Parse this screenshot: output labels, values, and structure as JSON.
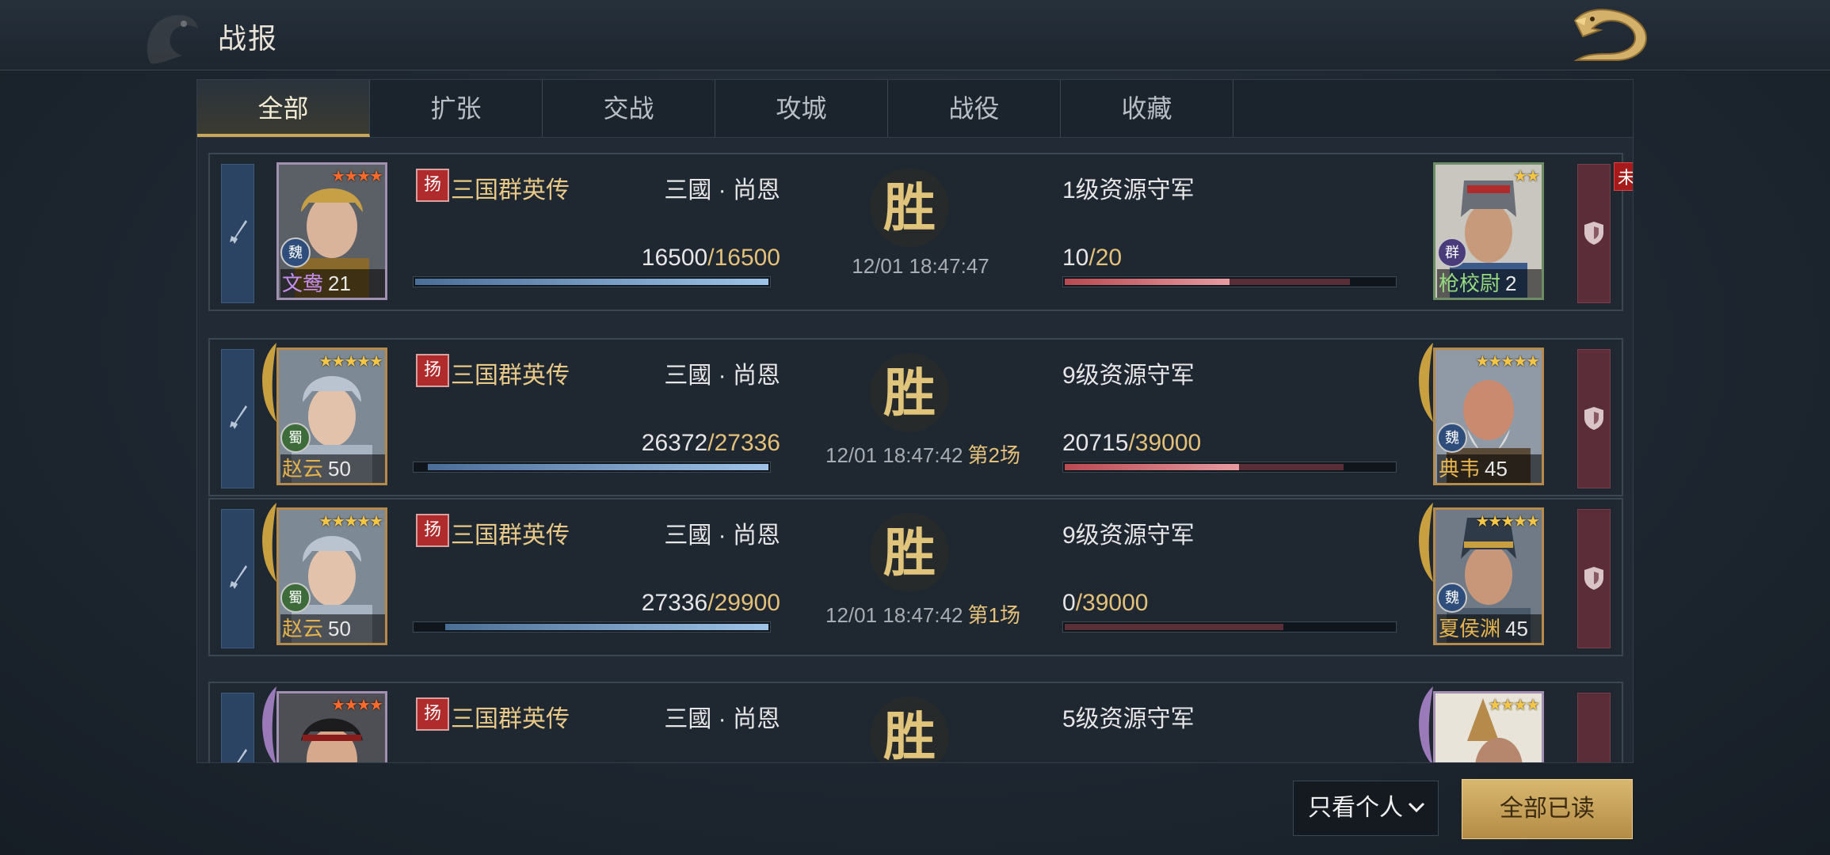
{
  "header": {
    "title": "战报",
    "back_icon": "dragon-back-icon"
  },
  "tabs": [
    {
      "label": "全部",
      "active": true
    },
    {
      "label": "扩张",
      "active": false
    },
    {
      "label": "交战",
      "active": false
    },
    {
      "label": "攻城",
      "active": false
    },
    {
      "label": "战役",
      "active": false
    },
    {
      "label": "收藏",
      "active": false
    }
  ],
  "unread_label": "未读",
  "reports": [
    {
      "server_tag": "扬",
      "server_name": "三国群英传",
      "player": "三國 · 尚恩",
      "attacker": {
        "name": "文鸯",
        "level": "21",
        "faction": "魏",
        "stars": "★★★★"
      },
      "att_troops": "16500",
      "att_max": "/16500",
      "att_ratio": 1.0,
      "result": "胜",
      "time": "12/01 18:47:47",
      "round": "",
      "enemy": "1级资源守军",
      "def_troops": "10",
      "def_max": "/20",
      "def_ratio": 0.5,
      "defender": {
        "name": "枪校尉",
        "level": "2",
        "faction": "群",
        "stars": "★★"
      }
    },
    {
      "server_tag": "扬",
      "server_name": "三国群英传",
      "player": "三國 · 尚恩",
      "attacker": {
        "name": "赵云",
        "level": "50",
        "faction": "蜀",
        "stars": "★★★★★"
      },
      "att_troops": "26372",
      "att_max": "/27336",
      "att_ratio": 0.965,
      "result": "胜",
      "time": "12/01 18:47:42",
      "round": "第2场",
      "enemy": "9级资源守军",
      "def_troops": "20715",
      "def_max": "/39000",
      "def_ratio": 0.53,
      "defender": {
        "name": "典韦",
        "level": "45",
        "faction": "魏",
        "stars": "★★★★★"
      }
    },
    {
      "server_tag": "扬",
      "server_name": "三国群英传",
      "player": "三國 · 尚恩",
      "attacker": {
        "name": "赵云",
        "level": "50",
        "faction": "蜀",
        "stars": "★★★★★"
      },
      "att_troops": "27336",
      "att_max": "/29900",
      "att_ratio": 0.914,
      "result": "胜",
      "time": "12/01 18:47:42",
      "round": "第1场",
      "enemy": "9级资源守军",
      "def_troops": "0",
      "def_max": "/39000",
      "def_ratio": 0.0,
      "defender": {
        "name": "夏侯渊",
        "level": "45",
        "faction": "魏",
        "stars": "★★★★★"
      }
    },
    {
      "server_tag": "扬",
      "server_name": "三国群英传",
      "player": "三國 · 尚恩",
      "attacker": {
        "name": "",
        "level": "",
        "faction": "",
        "stars": "★★★★"
      },
      "att_troops": "",
      "att_max": "",
      "att_ratio": 0,
      "result": "胜",
      "time": "",
      "round": "",
      "enemy": "5级资源守军",
      "def_troops": "",
      "def_max": "",
      "def_ratio": 0,
      "defender": {
        "name": "",
        "level": "",
        "faction": "",
        "stars": "★★★★"
      }
    }
  ],
  "footer": {
    "filter_label": "只看个人",
    "read_all_label": "全部已读"
  },
  "colors": {
    "accent_gold": "#c9a75a",
    "attacker_blue": "#2c4464",
    "defender_red": "#5a2d38"
  }
}
